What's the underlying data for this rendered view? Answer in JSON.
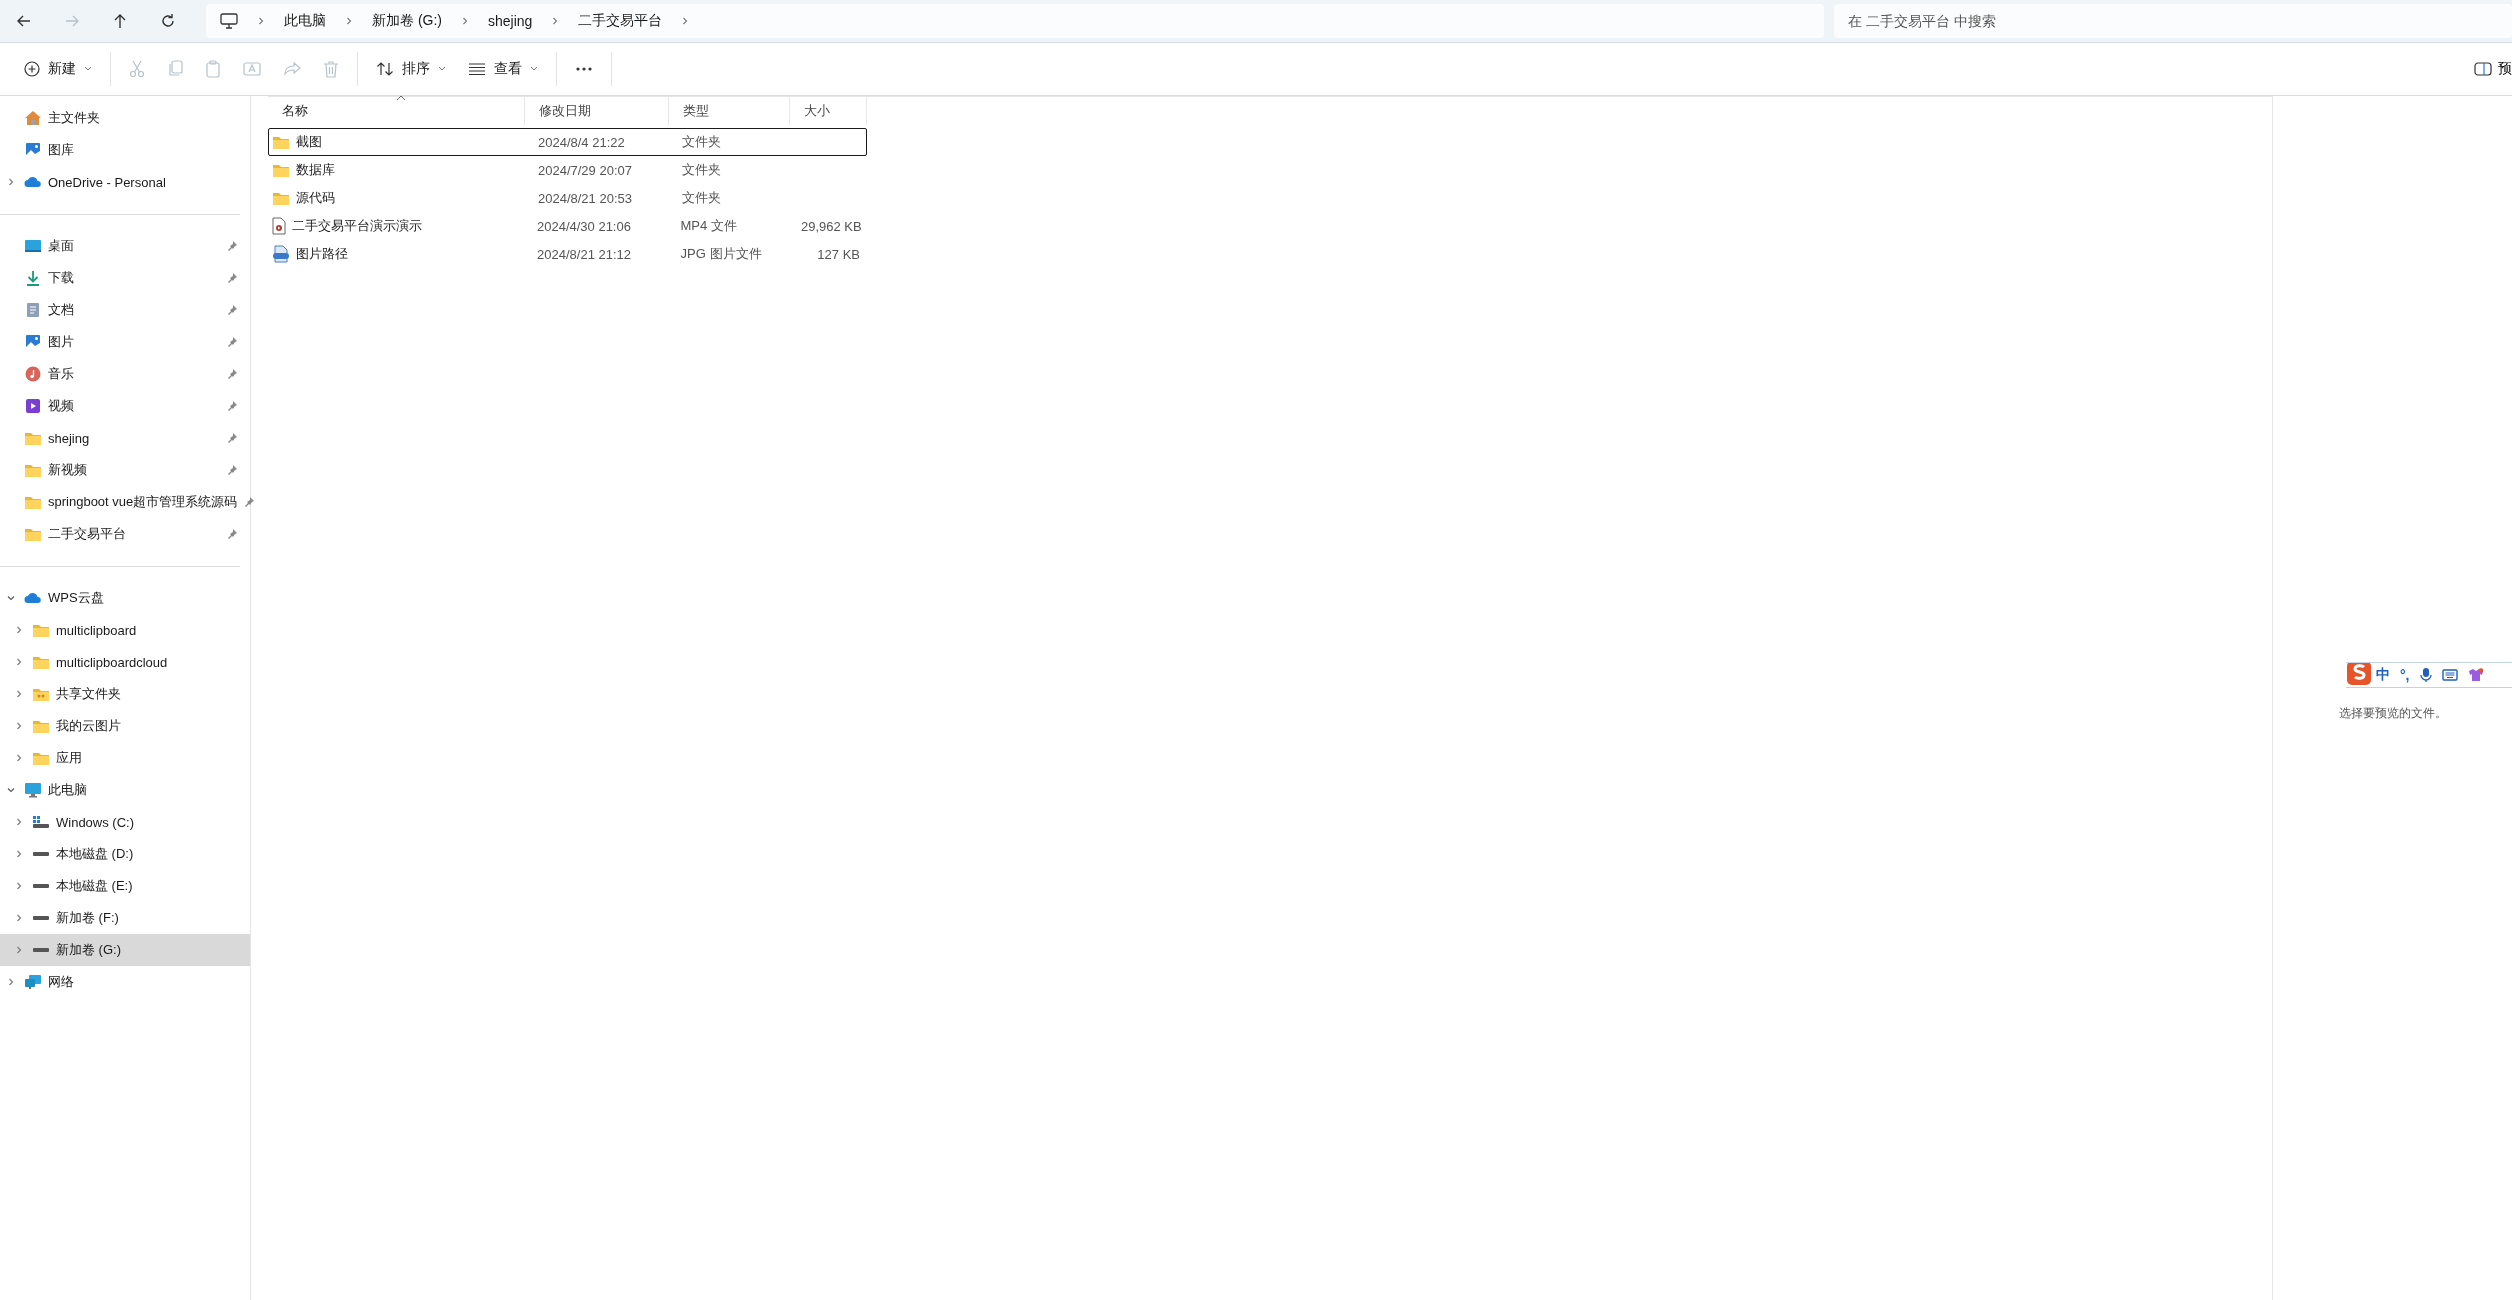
{
  "nav": [
    {
      "kind": "back",
      "disabled": false
    },
    {
      "kind": "forward",
      "disabled": true
    },
    {
      "kind": "up",
      "disabled": false
    },
    {
      "kind": "refresh",
      "disabled": false
    }
  ],
  "address": {
    "crumbs": [
      "此电脑",
      "新加卷 (G:)",
      "shejing",
      "二手交易平台"
    ]
  },
  "search": {
    "placeholder": "在 二手交易平台 中搜索"
  },
  "toolbar": {
    "groups": [
      {
        "buttons": [
          {
            "kind": "new",
            "label": "新建",
            "dropdown": true,
            "disabled": false
          }
        ]
      },
      {
        "buttons": [
          {
            "kind": "cut",
            "disabled": true
          },
          {
            "kind": "copy",
            "disabled": true
          },
          {
            "kind": "paste",
            "disabled": true
          },
          {
            "kind": "rename",
            "disabled": true
          },
          {
            "kind": "share",
            "disabled": true
          },
          {
            "kind": "delete",
            "disabled": true
          }
        ]
      },
      {
        "buttons": [
          {
            "kind": "sort",
            "label": "排序",
            "dropdown": true,
            "disabled": false
          },
          {
            "kind": "view",
            "label": "查看",
            "dropdown": true,
            "disabled": false
          }
        ]
      },
      {
        "buttons": [
          {
            "kind": "more",
            "disabled": false
          }
        ]
      }
    ]
  },
  "preview_toggle": {
    "label": "预"
  },
  "sidebar": {
    "sections": [
      {
        "items": [
          {
            "label": "主文件夹",
            "kind": "home",
            "selected": false
          },
          {
            "label": "图库",
            "kind": "gallery",
            "selected": false
          },
          {
            "label": "OneDrive - Personal",
            "kind": "cloud",
            "selected": false,
            "expanded": false
          }
        ]
      },
      {
        "items": [
          {
            "label": "桌面",
            "kind": "desktop",
            "selected": false,
            "pinned": true
          },
          {
            "label": "下载",
            "kind": "download",
            "selected": false,
            "pinned": true
          },
          {
            "label": "文档",
            "kind": "document",
            "selected": false,
            "pinned": true
          },
          {
            "label": "图片",
            "kind": "pictures",
            "selected": false,
            "pinned": true
          },
          {
            "label": "音乐",
            "kind": "music",
            "selected": false,
            "pinned": true
          },
          {
            "label": "视频",
            "kind": "video",
            "selected": false,
            "pinned": true
          },
          {
            "label": "shejing",
            "kind": "folder",
            "selected": false,
            "pinned": true
          },
          {
            "label": "新视频",
            "kind": "folder",
            "selected": false,
            "pinned": true
          },
          {
            "label": "springboot vue超市管理系统源码",
            "kind": "folder",
            "selected": false,
            "pinned": true
          },
          {
            "label": "二手交易平台",
            "kind": "folder",
            "selected": false,
            "pinned": true
          }
        ]
      },
      {
        "items": [
          {
            "label": "WPS云盘",
            "kind": "cloud",
            "selected": false,
            "expanded": true,
            "children": [
              {
                "label": "multiclipboard",
                "kind": "folder",
                "selected": false,
                "expanded": false
              },
              {
                "label": "multiclipboardcloud",
                "kind": "folder",
                "selected": false,
                "expanded": false
              },
              {
                "label": "共享文件夹",
                "kind": "shared",
                "selected": false,
                "expanded": false
              },
              {
                "label": "我的云图片",
                "kind": "folder",
                "selected": false,
                "expanded": false
              },
              {
                "label": "应用",
                "kind": "folder",
                "selected": false,
                "expanded": false
              }
            ]
          },
          {
            "label": "此电脑",
            "kind": "pc",
            "selected": false,
            "expanded": true,
            "children": [
              {
                "label": "Windows (C:)",
                "kind": "windrive",
                "selected": false,
                "expanded": false
              },
              {
                "label": "本地磁盘 (D:)",
                "kind": "drive",
                "selected": false,
                "expanded": false
              },
              {
                "label": "本地磁盘 (E:)",
                "kind": "drive",
                "selected": false,
                "expanded": false
              },
              {
                "label": "新加卷 (F:)",
                "kind": "drive",
                "selected": false,
                "expanded": false
              },
              {
                "label": "新加卷 (G:)",
                "kind": "drive",
                "selected": true,
                "expanded": false
              }
            ]
          },
          {
            "label": "网络",
            "kind": "network",
            "selected": false,
            "expanded": false
          }
        ]
      }
    ]
  },
  "files": {
    "columns": [
      {
        "label": "名称",
        "sorted": true
      },
      {
        "label": "修改日期",
        "sorted": false
      },
      {
        "label": "类型",
        "sorted": false
      },
      {
        "label": "大小",
        "sorted": false
      }
    ],
    "rows": [
      {
        "name": "截图",
        "date": "2024/8/4 21:22",
        "type": "文件夹",
        "kind": "folder",
        "focused": true
      },
      {
        "name": "数据库",
        "date": "2024/7/29 20:07",
        "type": "文件夹",
        "kind": "folder",
        "focused": false
      },
      {
        "name": "源代码",
        "date": "2024/8/21 20:53",
        "type": "文件夹",
        "kind": "folder",
        "focused": false
      },
      {
        "name": "二手交易平台演示演示",
        "date": "2024/4/30 21:06",
        "type": "MP4 文件",
        "size": "29,962 KB",
        "kind": "video",
        "focused": false
      },
      {
        "name": "图片路径",
        "date": "2024/8/21 21:12",
        "type": "JPG 图片文件",
        "size": "127 KB",
        "kind": "image",
        "focused": false
      }
    ]
  },
  "preview": {
    "message": "选择要预览的文件。"
  },
  "ime_toolbar": {
    "mode": "中",
    "punctuation": "°,"
  }
}
